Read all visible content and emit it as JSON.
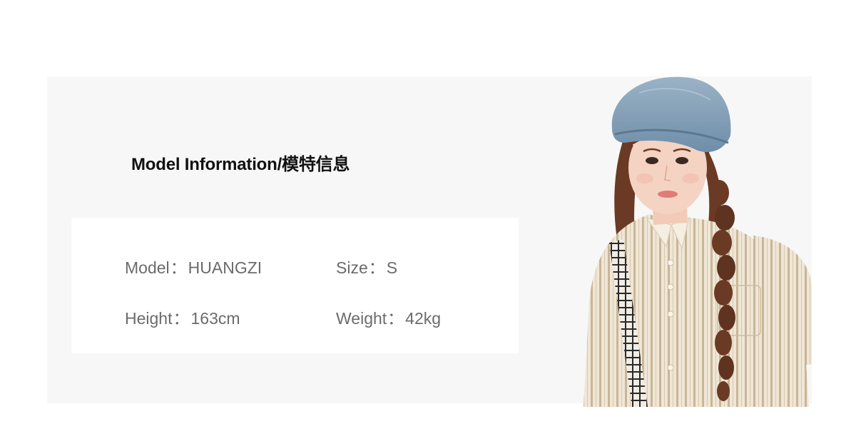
{
  "title": "Model Information/模特信息",
  "specs": {
    "model": {
      "label": "Model",
      "sep": "：",
      "value": "HUANGZI"
    },
    "size": {
      "label": "Size",
      "sep": "：",
      "value": "S"
    },
    "height": {
      "label": "Height",
      "sep": "：",
      "value": "163cm"
    },
    "weight": {
      "label": "Weight",
      "sep": "：",
      "value": "42kg"
    }
  },
  "colors": {
    "panel_bg": "#f7f7f7",
    "card_bg": "#ffffff",
    "title_text": "#111111",
    "spec_text": "#6b6b6b",
    "beret": "#7f9cb6",
    "hair": "#6a3a24",
    "shirt": "#efe6d6",
    "shirt_stripe": "#c9b697",
    "skin": "#f4d3c2"
  },
  "photo": {
    "subject": "model-photo",
    "items": [
      "denim-beret",
      "braided-hair",
      "striped-shirt",
      "checked-bag-strap"
    ]
  }
}
